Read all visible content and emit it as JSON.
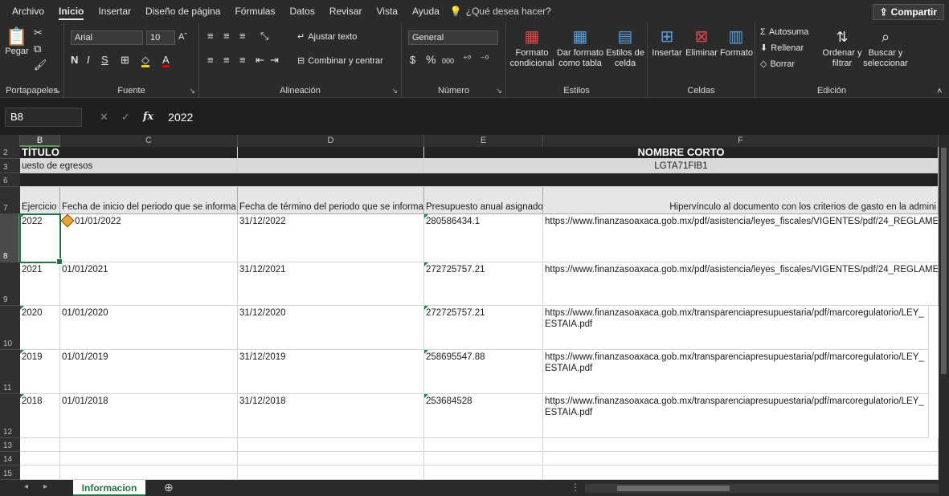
{
  "menu": {
    "tabs": [
      "Archivo",
      "Inicio",
      "Insertar",
      "Diseño de página",
      "Fórmulas",
      "Datos",
      "Revisar",
      "Vista",
      "Ayuda"
    ],
    "active_tab": "Inicio",
    "tell_me": "¿Qué desea hacer?",
    "share": "Compartir"
  },
  "ribbon": {
    "clipboard": {
      "paste": "Pegar",
      "label": "Portapapeles"
    },
    "font": {
      "name": "Arial",
      "size": "10",
      "label": "Fuente",
      "bold": "N",
      "italic": "I",
      "underline": "S"
    },
    "alignment": {
      "wrap": "Ajustar texto",
      "merge": "Combinar y centrar",
      "label": "Alineación"
    },
    "number": {
      "format": "General",
      "currency": "$",
      "percent": "%",
      "thousands": "000",
      "label": "Número"
    },
    "styles": {
      "conditional": "Formato condicional",
      "as_table": "Dar formato como tabla",
      "cell_styles": "Estilos de celda",
      "label": "Estilos"
    },
    "cells": {
      "insert": "Insertar",
      "delete": "Eliminar",
      "format": "Formato",
      "label": "Celdas"
    },
    "editing": {
      "autosum": "Autosuma",
      "fill": "Rellenar",
      "clear": "Borrar",
      "sort": "Ordenar y filtrar",
      "find": "Buscar y seleccionar",
      "label": "Edición"
    }
  },
  "formula_bar": {
    "name_box": "B8",
    "fx": "fx",
    "value": "2022"
  },
  "columns": [
    "B",
    "C",
    "D",
    "E",
    "F"
  ],
  "rows": {
    "r2": {
      "num": "2",
      "b": "TÍTULO",
      "f": "NOMBRE CORTO"
    },
    "r3": {
      "num": "3",
      "b": "uesto de egresos",
      "f": "LGTA71FIB1"
    },
    "r6": {
      "num": "6"
    },
    "r7": {
      "num": "7",
      "headers": [
        "Ejercicio",
        "Fecha de inicio del periodo que se informa",
        "Fecha de término del periodo que se informa",
        "Presupuesto anual asignado",
        "Hipervínculo al documento con los criterios de gasto en la admini"
      ]
    },
    "data": [
      {
        "num": "8",
        "ejercicio": "2022",
        "inicio": "01/01/2022",
        "termino": "31/12/2022",
        "presupuesto": "280586434.1",
        "link": "https://www.finanzasoaxaca.gob.mx/pdf/asistencia/leyes_fiscales/VIGENTES/pdf/24_REGLAMEN"
      },
      {
        "num": "9",
        "ejercicio": "2021",
        "inicio": "01/01/2021",
        "termino": "31/12/2021",
        "presupuesto": "272725757.21",
        "link": "https://www.finanzasoaxaca.gob.mx/pdf/asistencia/leyes_fiscales/VIGENTES/pdf/24_REGLAMEN"
      },
      {
        "num": "10",
        "ejercicio": "2020",
        "inicio": "01/01/2020",
        "termino": "31/12/2020",
        "presupuesto": "272725757.21",
        "link": "https://www.finanzasoaxaca.gob.mx/transparenciapresupuestaria/pdf/marcoregulatorio/LEY_ESTAIA.pdf"
      },
      {
        "num": "11",
        "ejercicio": "2019",
        "inicio": "01/01/2019",
        "termino": "31/12/2019",
        "presupuesto": "258695547.88",
        "link": "https://www.finanzasoaxaca.gob.mx/transparenciapresupuestaria/pdf/marcoregulatorio/LEY_ESTAIA.pdf"
      },
      {
        "num": "12",
        "ejercicio": "2018",
        "inicio": "01/01/2018",
        "termino": "31/12/2018",
        "presupuesto": "253684528",
        "link": "https://www.finanzasoaxaca.gob.mx/transparenciapresupuestaria/pdf/marcoregulatorio/LEY_ESTAIA.pdf"
      }
    ],
    "empty": [
      "13",
      "14",
      "15"
    ]
  },
  "sheet_tab": "Informacion",
  "colors": {
    "accent": "#1e7145",
    "dark_bg": "#1f1f1f",
    "header_fill": "#e7e6e6",
    "title_fill": "#232323"
  }
}
